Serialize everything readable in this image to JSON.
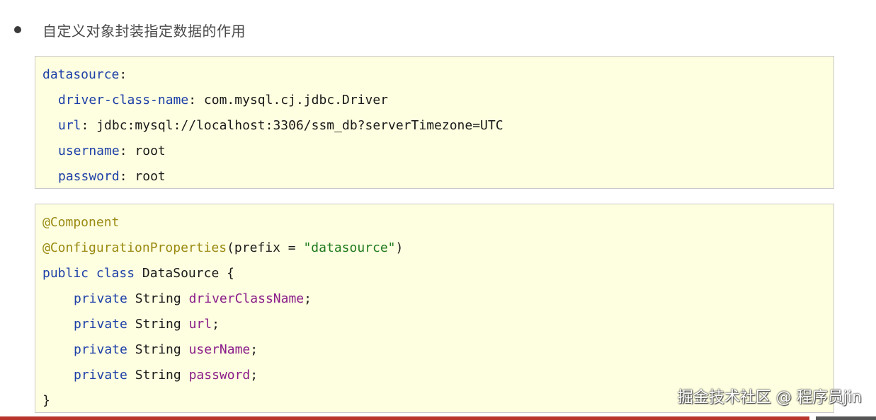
{
  "heading": "自定义对象封装指定数据的作用",
  "yaml_block": {
    "root_key": "datasource",
    "colon": ":",
    "entries": [
      {
        "key": "driver-class-name",
        "value": "com.mysql.cj.jdbc.Driver"
      },
      {
        "key": "url",
        "value": "jdbc:mysql://localhost:3306/ssm_db?serverTimezone=UTC"
      },
      {
        "key": "username",
        "value": "root"
      },
      {
        "key": "password",
        "value": "root"
      }
    ]
  },
  "java_block": {
    "annotation1": "@Component",
    "annotation2": "@ConfigurationProperties",
    "annotation2_open": "(prefix = ",
    "annotation2_value": "\"datasource\"",
    "annotation2_close": ")",
    "kw_public": "public",
    "kw_class": "class",
    "class_decl": "DataSource {",
    "fields": [
      {
        "modifier": "private",
        "type": "String",
        "name": "driverClassName",
        "end": ";"
      },
      {
        "modifier": "private",
        "type": "String",
        "name": "url",
        "end": ";"
      },
      {
        "modifier": "private",
        "type": "String",
        "name": "userName",
        "end": ";"
      },
      {
        "modifier": "private",
        "type": "String",
        "name": "password",
        "end": ";"
      }
    ],
    "closing_brace": "}"
  },
  "watermark": "掘金技术社区 @ 程序员jin",
  "colors": {
    "code_bg": "#fefee0",
    "key_blue": "#1c3fa8",
    "annotation": "#9a8a12",
    "string_green": "#1d7a1d",
    "field_purple": "#8a1c8a",
    "bottom_bar_red": "#b8342c"
  }
}
